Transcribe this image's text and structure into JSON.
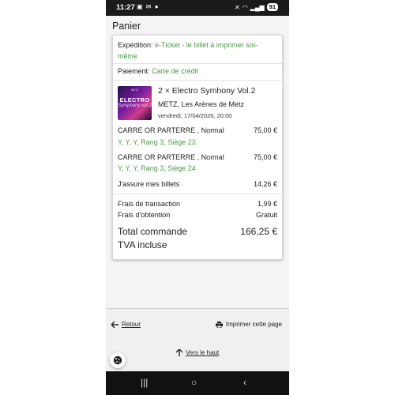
{
  "status_bar": {
    "time": "11:27",
    "notification_icons": [
      "image-icon",
      "mail-icon",
      "message-icon"
    ],
    "battery": "91"
  },
  "page": {
    "title": "Panier"
  },
  "cart": {
    "expedition": {
      "label": "Expédition:",
      "value": "e-Ticket - le billet à imprimer soi-",
      "value_line2": "même"
    },
    "payment": {
      "label": "Paiement:",
      "value": "Carte de crédit"
    },
    "event": {
      "image_title": "ELECTRO",
      "image_subtitle": "Symphony vol.2",
      "image_top": "METZ",
      "title": "2 × Electro Symhony Vol.2",
      "venue": "METZ, Les Arènes de Metz",
      "date": "vendredi, 17/04/2026, 20:00"
    },
    "tickets": [
      {
        "category": "CARRE OR PARTERRE , Normal",
        "seat": "Y, Y, Y, Rang 3, Siège 23",
        "price": "75,00 €"
      },
      {
        "category": "CARRE OR PARTERRE , Normal",
        "seat": "Y, Y, Y, Rang 3, Siège 24",
        "price": "75,00 €"
      }
    ],
    "insurance": {
      "label": "J'assure mes billets",
      "price": "14,26 €"
    },
    "fees": [
      {
        "label": "Frais de transaction",
        "value": "1,99 €"
      },
      {
        "label": "Frais d'obtention",
        "value": "Gratuit"
      }
    ],
    "total": {
      "label": "Total commande",
      "value": "166,25 €",
      "tax_note": "TVA incluse"
    }
  },
  "footer": {
    "back_label": "Retour",
    "print_label": "Imprimer cette page",
    "top_label": "Vers le haut"
  },
  "colors": {
    "accent_green": "#4a9b47"
  }
}
